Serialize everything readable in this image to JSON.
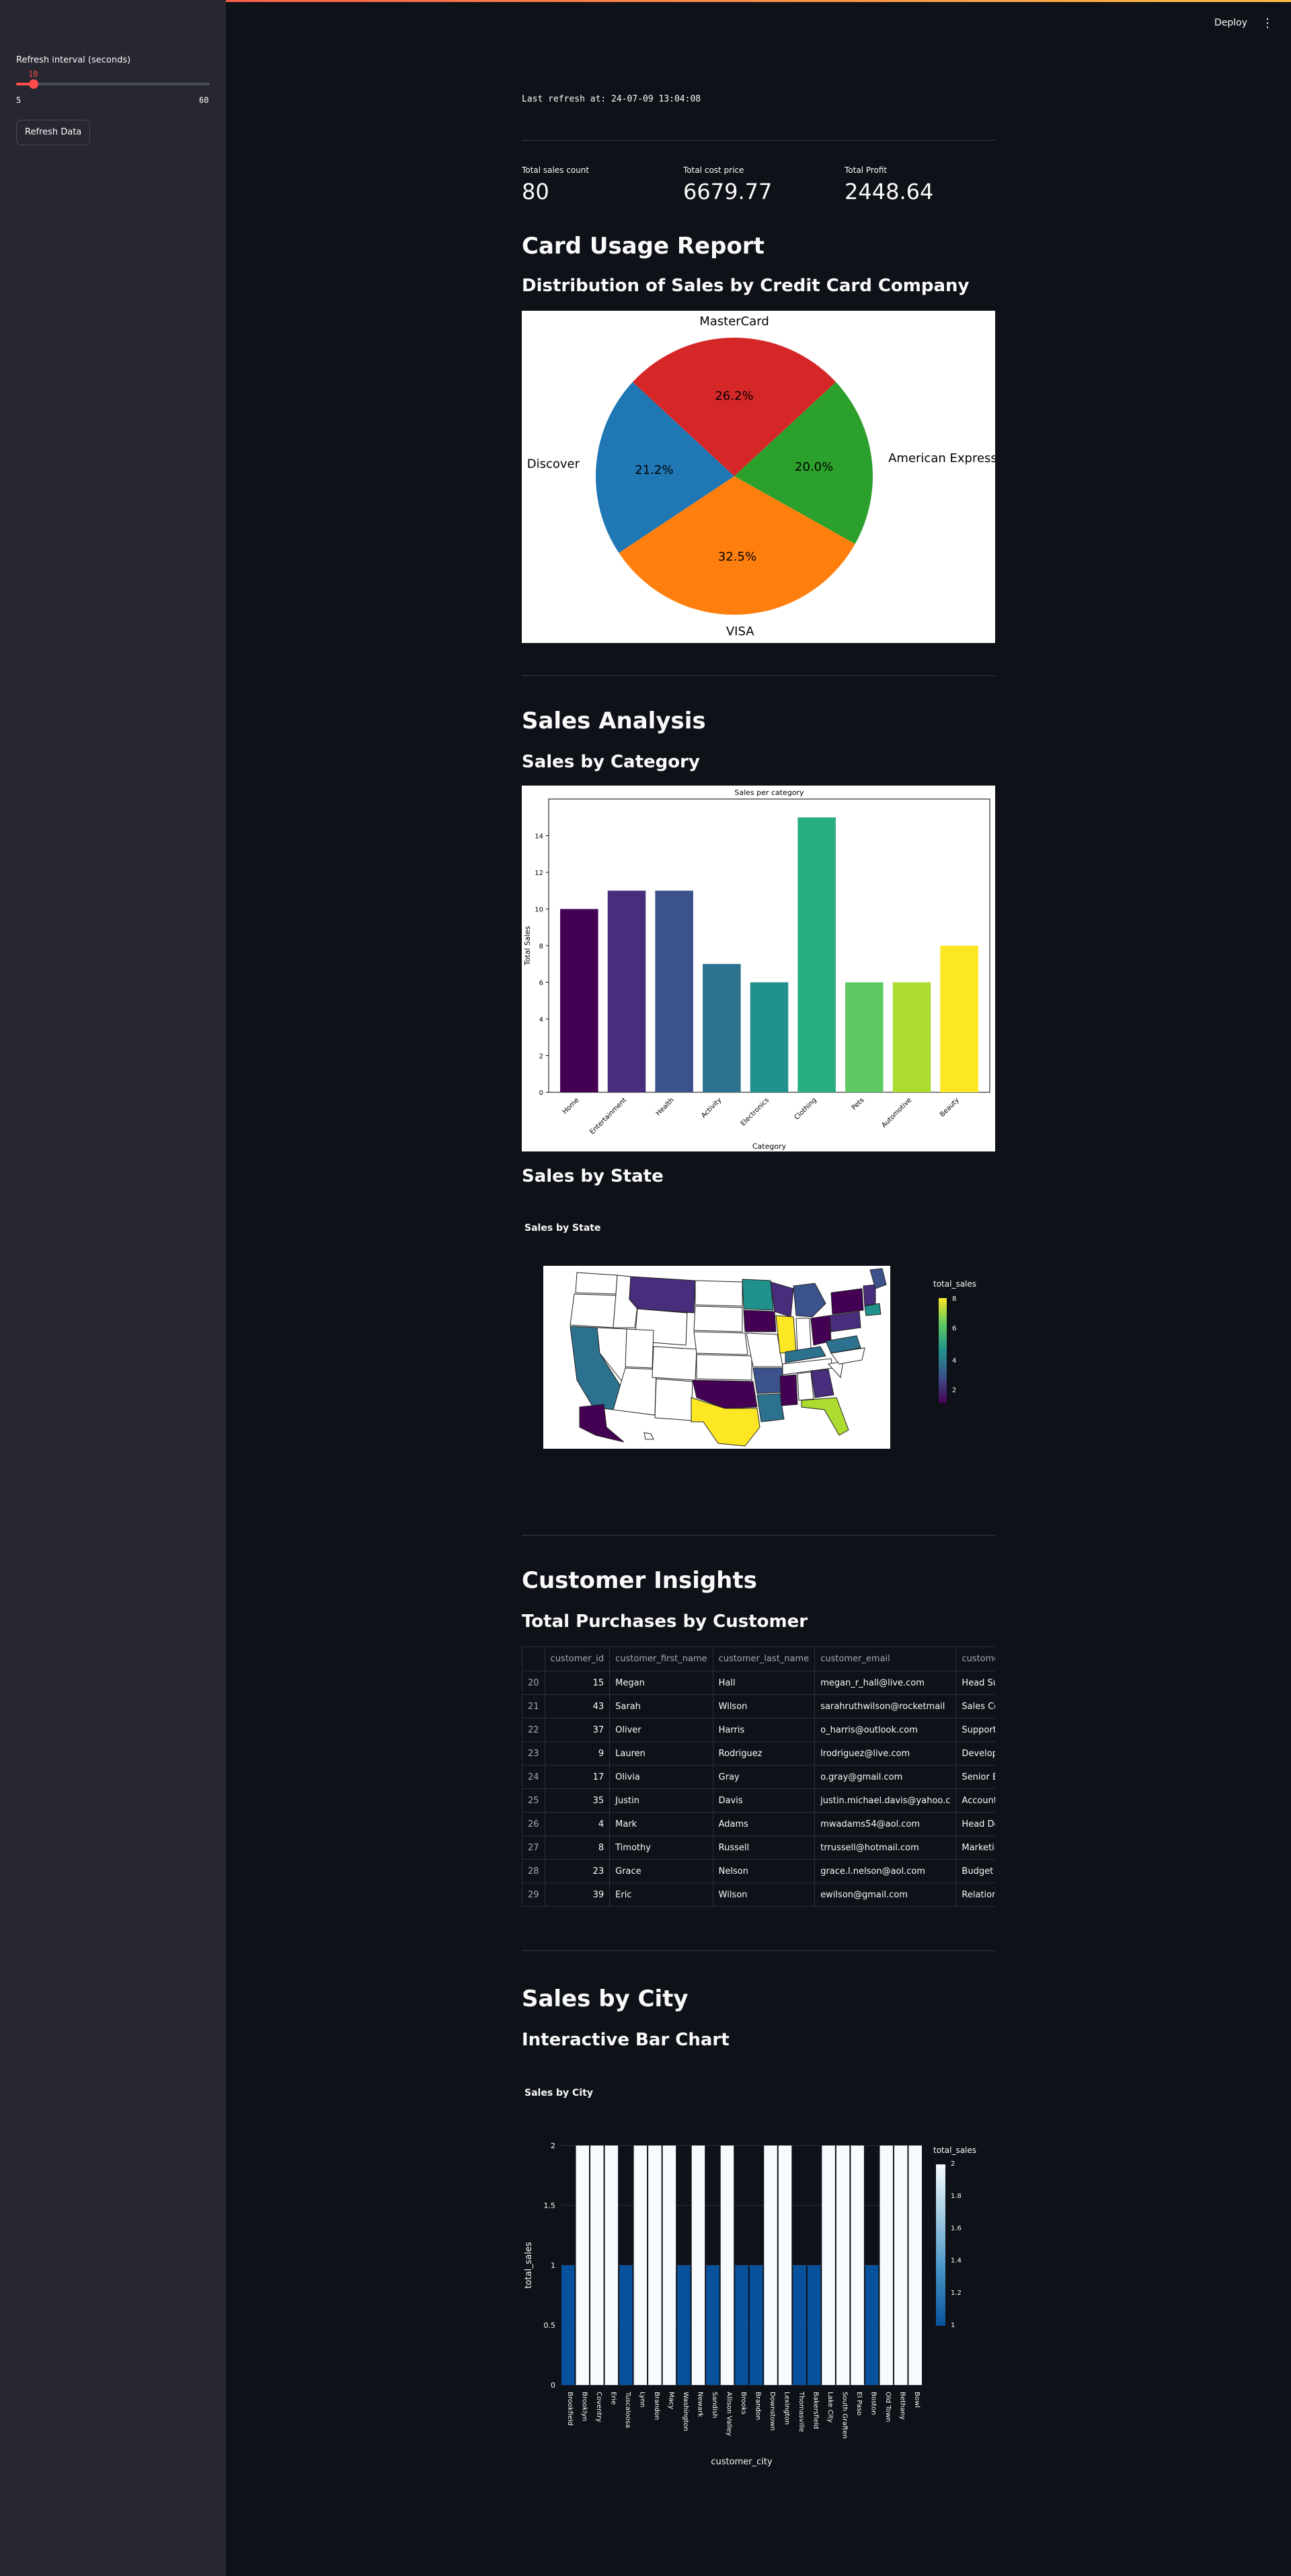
{
  "sidebar": {
    "slider_label": "Refresh interval (seconds)",
    "slider_value": 10,
    "slider_value_text": "10",
    "slider_min": "5",
    "slider_max": "60",
    "refresh_button": "Refresh Data"
  },
  "topbar": {
    "deploy": "Deploy",
    "menu": "⋮"
  },
  "last_refresh": "Last refresh at: 24-07-09 13:04:08",
  "metrics": [
    {
      "label": "Total sales count",
      "value": "80"
    },
    {
      "label": "Total cost price",
      "value": "6679.77"
    },
    {
      "label": "Total Profit",
      "value": "2448.64"
    }
  ],
  "card_report": {
    "header": "Card Usage Report",
    "subheader": "Distribution of Sales by Credit Card Company"
  },
  "sales_analysis": {
    "header": "Sales Analysis",
    "subheader": "Sales by Category"
  },
  "state": {
    "subheader": "Sales by State",
    "plot_title": "Sales by State",
    "colorbar_title": "total_sales",
    "colorbar_ticks": [
      "8",
      "6",
      "4",
      "2"
    ]
  },
  "customer": {
    "header": "Customer Insights",
    "subheader": "Total Purchases by Customer",
    "columns": [
      "",
      "customer_id",
      "customer_first_name",
      "customer_last_name",
      "customer_email",
      "customer_job"
    ],
    "rows": [
      [
        "20",
        "15",
        "Megan",
        "Hall",
        "megan_r_hall@live.com",
        "Head Support M"
      ],
      [
        "21",
        "43",
        "Sarah",
        "Wilson",
        "sarahruthwilson@rocketmail",
        "Sales Consultan"
      ],
      [
        "22",
        "37",
        "Oliver",
        "Harris",
        "o_harris@outlook.com",
        "Support Executi"
      ],
      [
        "23",
        "9",
        "Lauren",
        "Rodriguez",
        "lrodriguez@live.com",
        "Development Co"
      ],
      [
        "24",
        "17",
        "Olivia",
        "Gray",
        "o.gray@gmail.com",
        "Senior Editor"
      ],
      [
        "25",
        "35",
        "Justin",
        "Davis",
        "justin.michael.davis@yahoo.c",
        "Accounting Adm"
      ],
      [
        "26",
        "4",
        "Mark",
        "Adams",
        "mwadams54@aol.com",
        "Head Developer"
      ],
      [
        "27",
        "8",
        "Timothy",
        "Russell",
        "trrussell@hotmail.com",
        "Marketing Speci"
      ],
      [
        "28",
        "23",
        "Grace",
        "Nelson",
        "grace.l.nelson@aol.com",
        "Budget Consulta"
      ],
      [
        "29",
        "39",
        "Eric",
        "Wilson",
        "ewilson@gmail.com",
        "Relations Consu"
      ]
    ]
  },
  "city": {
    "header": "Sales by City",
    "subheader": "Interactive Bar Chart",
    "plot_title": "Sales by City",
    "colorbar_title": "total_sales",
    "colorbar_ticks": [
      "2",
      "1.8",
      "1.6",
      "1.4",
      "1.2",
      "1"
    ]
  },
  "chart_data": [
    {
      "type": "pie",
      "categories": [
        "MasterCard",
        "American Express",
        "VISA",
        "Discover"
      ],
      "values": [
        26.2,
        20.0,
        32.5,
        21.2
      ],
      "labels": [
        "26.2%",
        "20.0%",
        "32.5%",
        "21.2%"
      ],
      "colors": [
        "#d62728",
        "#2ca02c",
        "#ff7f0e",
        "#1f77b4"
      ]
    },
    {
      "type": "bar",
      "title": "Sales per category",
      "xlabel": "Category",
      "ylabel": "Total Sales",
      "categories": [
        "Home",
        "Entertainment",
        "Health",
        "Activity",
        "Electronics",
        "Clothing",
        "Pets",
        "Automotive",
        "Beauty"
      ],
      "values": [
        10,
        11,
        11,
        7,
        6,
        15,
        6,
        6,
        8
      ],
      "ylim": [
        0,
        16
      ],
      "yticks": [
        0,
        2,
        4,
        6,
        8,
        10,
        12,
        14
      ],
      "colors": [
        "#440154",
        "#472d7b",
        "#3b528b",
        "#2c728e",
        "#21918c",
        "#28ae80",
        "#5ec962",
        "#addc30",
        "#fde725"
      ]
    },
    {
      "type": "bar",
      "title": "Sales by City",
      "xlabel": "customer_city",
      "ylabel": "total_sales",
      "ylim": [
        0,
        2
      ],
      "yticks": [
        "0",
        "0.5",
        "1",
        "1.5",
        "2"
      ],
      "categories": [
        "Brookfield",
        "Brooklyn",
        "Coventry",
        "Erie",
        "Tuscaloosa",
        "Lynn",
        "Brandon",
        "Macy",
        "Washington",
        "Newark",
        "Sandish",
        "Allison Valley",
        "Brooks",
        "Brandon",
        "Downstown",
        "Lexington",
        "Thomasville",
        "Bakersfield",
        "Lake City",
        "South Graften",
        "El Paso",
        "Boston",
        "Old Town",
        "Bethany",
        "Bowl"
      ],
      "values": [
        1,
        2,
        2,
        2,
        1,
        2,
        2,
        2,
        1,
        2,
        1,
        2,
        1,
        1,
        2,
        2,
        1,
        1,
        2,
        2,
        2,
        1,
        2,
        2,
        2
      ]
    }
  ]
}
